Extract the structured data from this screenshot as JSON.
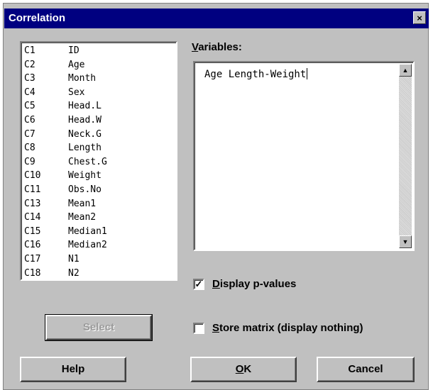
{
  "window": {
    "title": "Correlation",
    "close_label": "×"
  },
  "columns_list": [
    {
      "id": "C1",
      "name": "ID"
    },
    {
      "id": "C2",
      "name": "Age"
    },
    {
      "id": "C3",
      "name": "Month"
    },
    {
      "id": "C4",
      "name": "Sex"
    },
    {
      "id": "C5",
      "name": "Head.L"
    },
    {
      "id": "C6",
      "name": "Head.W"
    },
    {
      "id": "C7",
      "name": "Neck.G"
    },
    {
      "id": "C8",
      "name": "Length"
    },
    {
      "id": "C9",
      "name": "Chest.G"
    },
    {
      "id": "C10",
      "name": "Weight"
    },
    {
      "id": "C11",
      "name": "Obs.No"
    },
    {
      "id": "C13",
      "name": "Mean1"
    },
    {
      "id": "C14",
      "name": "Mean2"
    },
    {
      "id": "C15",
      "name": "Median1"
    },
    {
      "id": "C16",
      "name": "Median2"
    },
    {
      "id": "C17",
      "name": "N1"
    },
    {
      "id": "C18",
      "name": "N2"
    }
  ],
  "variables": {
    "label_accel": "V",
    "label_rest": "ariables:",
    "value": "Age Length-Weight"
  },
  "scrollbar": {
    "up_glyph": "▲",
    "down_glyph": "▼"
  },
  "options": {
    "display_pvalues": {
      "accel": "D",
      "rest": "isplay p-values",
      "checked": true,
      "mark": "✓"
    },
    "store_matrix": {
      "accel": "S",
      "rest": "tore matrix (display nothing)",
      "checked": false,
      "mark": ""
    }
  },
  "buttons": {
    "select": "Select",
    "help": "Help",
    "ok_accel": "O",
    "ok_rest": "K",
    "cancel": "Cancel"
  }
}
